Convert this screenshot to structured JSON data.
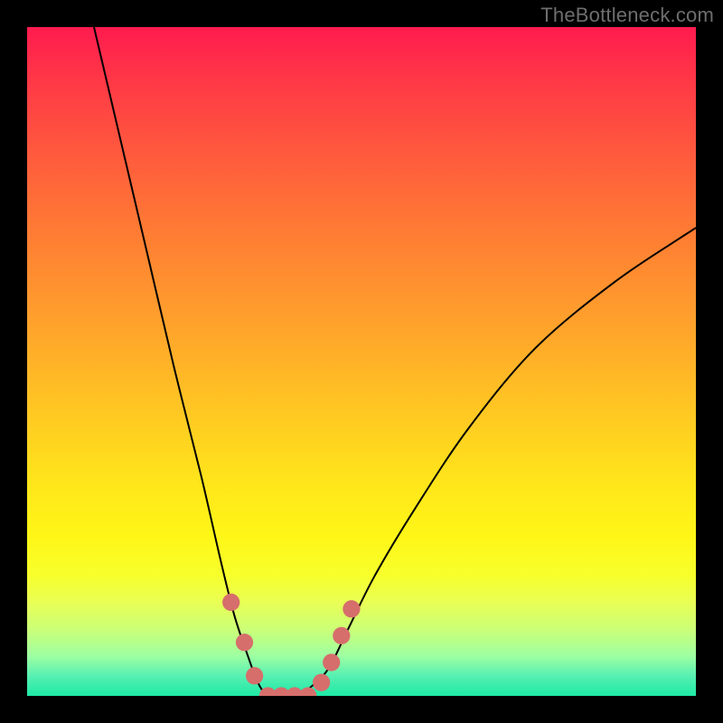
{
  "attribution": "TheBottleneck.com",
  "chart_data": {
    "type": "line",
    "title": "",
    "xlabel": "",
    "ylabel": "",
    "xlim": [
      0,
      100
    ],
    "ylim": [
      0,
      100
    ],
    "series": [
      {
        "name": "bottleneck-curve",
        "x": [
          10,
          14,
          18,
          22,
          26,
          29,
          31,
          33,
          34.5,
          36,
          38,
          40,
          42,
          45,
          48,
          52,
          58,
          66,
          76,
          88,
          100
        ],
        "values": [
          100,
          83,
          66,
          49,
          33,
          20,
          12,
          6,
          2,
          0,
          0,
          0,
          1,
          4,
          10,
          18,
          28,
          40,
          52,
          62,
          70
        ]
      }
    ],
    "markers": {
      "name": "highlighted-points",
      "x": [
        30.5,
        32.5,
        34,
        36,
        38,
        40,
        42,
        44,
        45.5,
        47,
        48.5
      ],
      "values": [
        14,
        8,
        3,
        0,
        0,
        0,
        0,
        2,
        5,
        9,
        13
      ],
      "color": "#d66e6c",
      "radius": 1.3
    },
    "background_gradient": {
      "direction": "vertical",
      "stops": [
        {
          "pos": 0,
          "color": "#ff1b4f"
        },
        {
          "pos": 18,
          "color": "#ff573e"
        },
        {
          "pos": 42,
          "color": "#ff9b2d"
        },
        {
          "pos": 68,
          "color": "#ffe51b"
        },
        {
          "pos": 86,
          "color": "#e9ff55"
        },
        {
          "pos": 100,
          "color": "#1de9a6"
        }
      ]
    }
  }
}
